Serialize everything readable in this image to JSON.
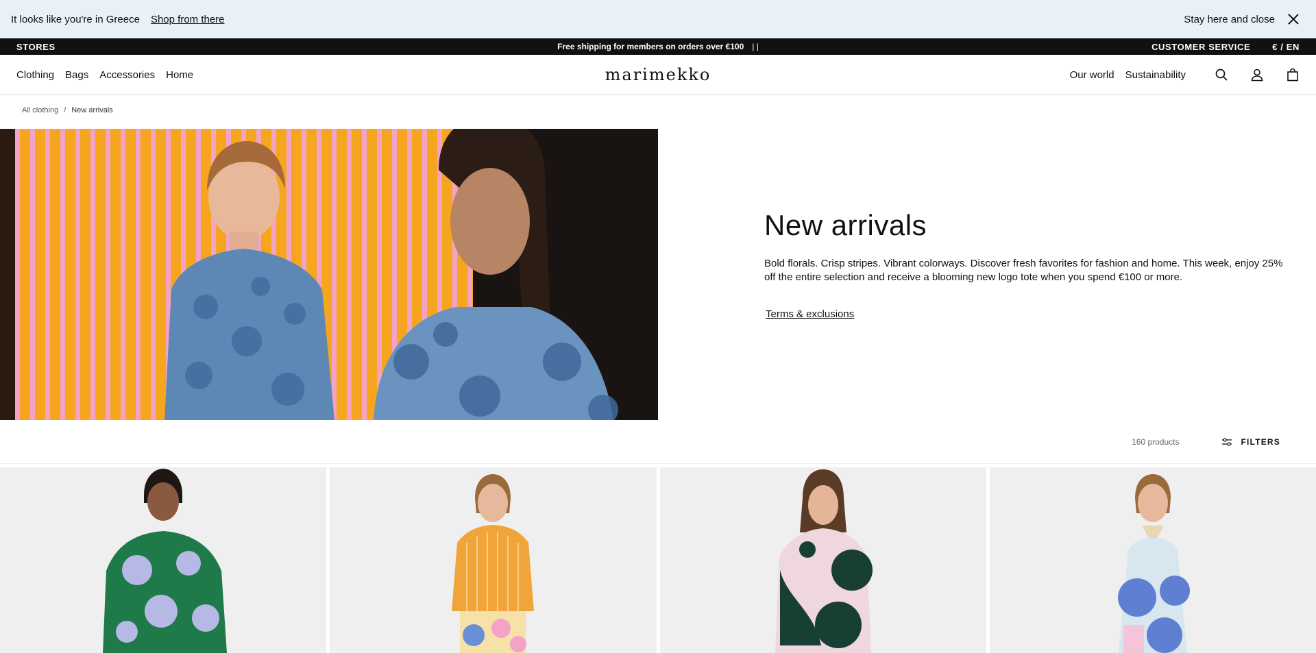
{
  "geo_banner": {
    "message": "It looks like you're in Greece",
    "shop_link": "Shop from there",
    "stay_label": "Stay here and close"
  },
  "top_strip": {
    "stores": "STORES",
    "promo": "Free shipping for members on orders over €100",
    "promo_sep": "| |",
    "customer_service": "CUSTOMER SERVICE",
    "currency_lang": "€ / EN"
  },
  "nav": {
    "left_items": [
      "Clothing",
      "Bags",
      "Accessories",
      "Home"
    ],
    "logo": "marimekko",
    "right_items": [
      "Our world",
      "Sustainability"
    ],
    "icons": [
      "search-icon",
      "account-icon",
      "bag-icon"
    ]
  },
  "breadcrumb": {
    "items": [
      "All clothing",
      "New arrivals"
    ],
    "separator": "/"
  },
  "hero": {
    "title": "New arrivals",
    "description": "Bold florals. Crisp stripes. Vibrant colorways. Discover fresh favorites for fashion and home. This week, enjoy 25% off the entire selection and receive a blooming new logo tote when you spend €100 or more.",
    "terms_link": "Terms & exclusions"
  },
  "toolbar": {
    "product_count": "160 products",
    "filters_label": "FILTERS"
  },
  "colors": {
    "banner_bg": "#e9f0f8",
    "strip_bg": "#111111",
    "card_bg": "#efefef",
    "stripe_orange": "#f6a61e",
    "stripe_pink": "#f4a3c6",
    "denim": "#5d87b4"
  }
}
